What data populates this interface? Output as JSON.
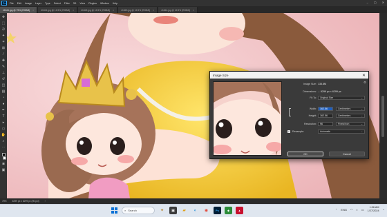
{
  "app": {
    "logo": "Ps"
  },
  "menu": [
    "File",
    "Edit",
    "Image",
    "Layer",
    "Type",
    "Select",
    "Filter",
    "3D",
    "View",
    "Plugins",
    "Window",
    "Help"
  ],
  "tabs": [
    {
      "label": "41841.jpg @ 75% (RGB/8)",
      "active": true
    },
    {
      "label": "41841.jpg @ 12.5% (RGB/8)",
      "active": false
    },
    {
      "label": "41842.jpg @ 12.5% (RGB/8)",
      "active": false
    },
    {
      "label": "41843.jpg @ 12.5% (RGB/8)",
      "active": false
    },
    {
      "label": "41844.jpg @ 12.5% (RGB/8)",
      "active": false
    }
  ],
  "dialog": {
    "title": "Image Size",
    "image_size_label": "Image Size:",
    "image_size_value": "135.8M",
    "dimensions_label": "Dimensions:",
    "dimensions_value": "⌄ 6299 px  ×  6299 px",
    "fit_to_label": "Fit To:",
    "fit_to_value": "Original Size",
    "width_label": "Width:",
    "width_value": "162.56",
    "width_unit": "Centimeters",
    "height_label": "Height:",
    "height_value": "162.56",
    "height_unit": "Centimeters",
    "resolution_label": "Resolution:",
    "resolution_value": "96",
    "resolution_unit": "Pixels/Inch",
    "resample_label": "Resample:",
    "resample_value": "Automatic",
    "ok_label": "OK",
    "cancel_label": "Cancel"
  },
  "statusbar": {
    "zoom": "75%",
    "info": "6299 px x 6299 px (96 ppi)"
  },
  "taskbar": {
    "search_placeholder": "Search",
    "lang": "ENG",
    "time": "1:06 AM",
    "date": "1/27/2024"
  },
  "colors": {
    "accent": "#31a8ff",
    "selection": "#1f5fbf",
    "dialog_bg": "#3a3a3a"
  }
}
